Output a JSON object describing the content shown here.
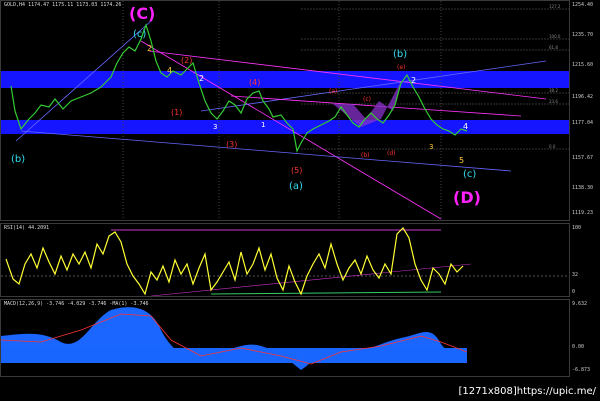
{
  "price_pane": {
    "header": "GOLD,H4  1174.47 1175.11 1173.03 1174.26",
    "current_price": "1174.26",
    "axis_labels": [
      "1254.40",
      "1235.70",
      "1215.60",
      "1196.42",
      "1177.04",
      "1157.67",
      "1138.30",
      "1119.23"
    ],
    "fib_labels": [
      "127.2",
      "100.0",
      "61.8",
      "38.2",
      "23.6",
      "0.0"
    ],
    "wave_labels": {
      "C_big": "(C)",
      "c_top": "(c)",
      "b_left": "(b)",
      "b_right": "(b)",
      "a_low": "(a)",
      "c_right": "(c)",
      "D_big": "(D)",
      "n2_red": "(2)",
      "n4_red": "(4)",
      "n1_red": "(1)",
      "n3_red": "(3)",
      "n5_red": "(5)",
      "a_small": "(a)",
      "c_small": "(c)",
      "e_small": "(e)",
      "b_small": "(b)",
      "d_small": "(d)",
      "y2": "2",
      "y4": "4",
      "y5": "5",
      "y3": "3",
      "y1": "1"
    }
  },
  "rsi_pane": {
    "header": "RSI(14) 44.2091",
    "axis_labels": [
      "100",
      "32",
      "0"
    ]
  },
  "macd_pane": {
    "header": "MACD(12,26,9) -3.746 -4.029   -3.746  -MA(1) -3.746",
    "axis_labels": [
      "9.632",
      "0.00",
      "-6.873"
    ]
  },
  "watermark": "[1271x808]https://upic.me/"
}
